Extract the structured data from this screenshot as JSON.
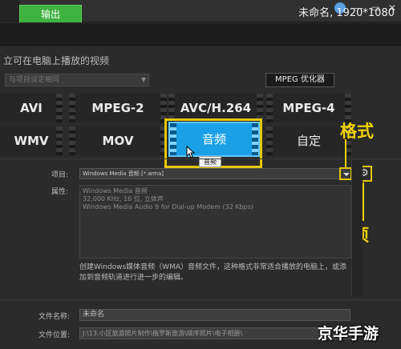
{
  "tabs": {
    "output": "输出"
  },
  "project": {
    "info": "未命名, 1920*1080"
  },
  "header": {
    "text": "立可在电脑上播放的视频"
  },
  "preset": {
    "placeholder": "与项目设定相同"
  },
  "mpeg_optimizer": {
    "label": "MPEG 优化器"
  },
  "formats": {
    "row1": [
      "AVI",
      "MPEG-2",
      "AVC/H.264",
      "MPEG-4"
    ],
    "row2": [
      "WMV",
      "MOV",
      "音频",
      "自定"
    ]
  },
  "tooltip": "音频",
  "annotations": {
    "format": "格式",
    "options": "选项"
  },
  "settings": {
    "item_label": "项目:",
    "item_value": "Windows Media 音频 [*.wma]",
    "props_label": "属性:",
    "props_lines": [
      "Windows Media 音频",
      "32,000 KHz, 16 位, 立体声",
      "Windows Media Audio 9 for Dial-up Modem (32 Kbps)"
    ],
    "description": "创建Windows媒体音频（WMA）音频文件，这种格式非常适合播放的电脑上，或添加到音频轨道进行进一步的编辑。"
  },
  "file": {
    "name_label": "文件名称:",
    "name_value": "未命名",
    "path_label": "文件位置:",
    "path_value": "J:\\13.小区旅游照片制作\\俄罗斯旅游\\顺序照片\\电子相册\\"
  },
  "watermark": "京华手游",
  "colors": {
    "tab_green": "#3fb23f",
    "selected_blue": "#1aa0e6",
    "highlight_yellow": "#e6c800"
  }
}
